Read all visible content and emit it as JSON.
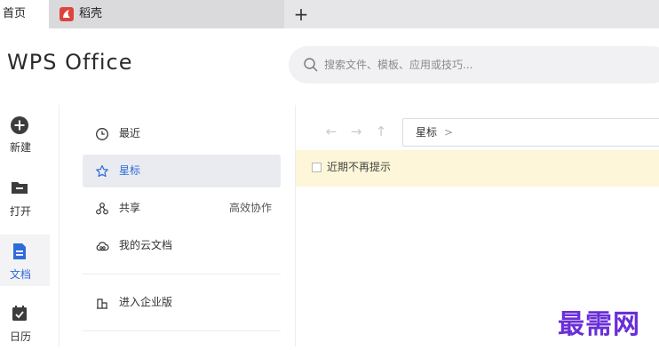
{
  "tabs": {
    "home_label": "首页",
    "doc_label": "稻壳",
    "new_tab_label": "+"
  },
  "header": {
    "brand": "WPS Office",
    "search_placeholder": "搜索文件、模板、应用或技巧..."
  },
  "rail": [
    {
      "label": "新建",
      "icon": "plus-circle-icon"
    },
    {
      "label": "打开",
      "icon": "folder-icon"
    },
    {
      "label": "文档",
      "icon": "document-icon",
      "active": true
    },
    {
      "label": "日历",
      "icon": "calendar-icon"
    }
  ],
  "nav": {
    "recent": "最近",
    "starred": "星标",
    "shared": "共享",
    "shared_extra": "高效协作",
    "cloud": "我的云文档",
    "enterprise": "进入企业版"
  },
  "content": {
    "back_arrow": "←",
    "forward_arrow": "→",
    "up_arrow": "↑",
    "path": "星标",
    "path_chevron": ">",
    "banner_text": "近期不再提示"
  },
  "watermark": "最需网",
  "colors": {
    "accent": "#2f6bd8",
    "tab_bar": "#e6e6e9",
    "banner_bg": "#fdf6d8",
    "active_nav_bg": "#e9ebf1",
    "watermark": "#6a2ed8",
    "docer_logo": "#e0433b"
  }
}
